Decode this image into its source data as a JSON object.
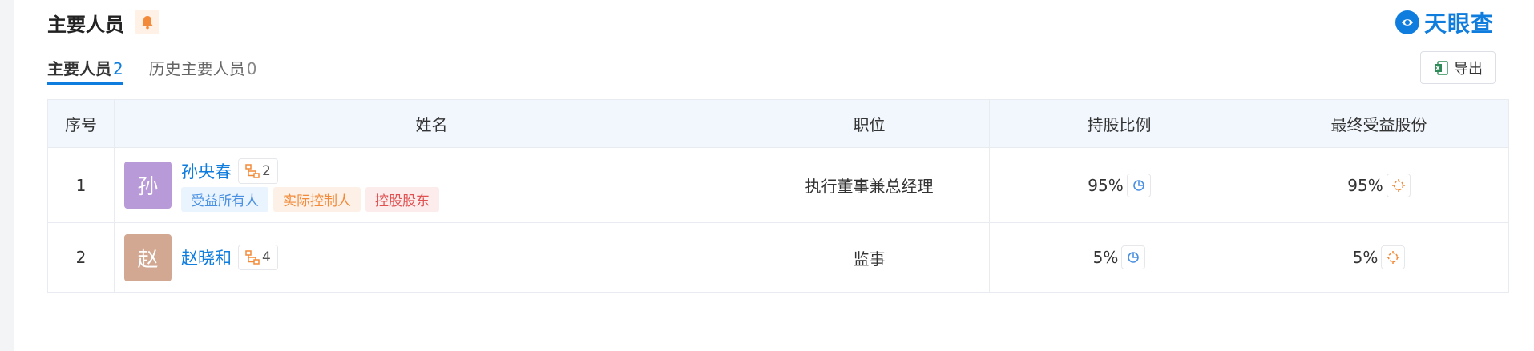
{
  "header": {
    "title": "主要人员",
    "logo_text": "天眼查"
  },
  "tabs": [
    {
      "label": "主要人员",
      "count": "2"
    },
    {
      "label": "历史主要人员",
      "count": "0"
    }
  ],
  "export_label": "导出",
  "table": {
    "columns": [
      "序号",
      "姓名",
      "职位",
      "持股比例",
      "最终受益股份"
    ],
    "rows": [
      {
        "index": "1",
        "avatar_char": "孙",
        "avatar_color": "#b99ad8",
        "name": "孙央春",
        "relation_count": "2",
        "tags": [
          "受益所有人",
          "实际控制人",
          "控股股东"
        ],
        "position": "执行董事兼总经理",
        "shareholding": "95%",
        "beneficial": "95%"
      },
      {
        "index": "2",
        "avatar_char": "赵",
        "avatar_color": "#d3a893",
        "name": "赵晓和",
        "relation_count": "4",
        "tags": [],
        "position": "监事",
        "shareholding": "5%",
        "beneficial": "5%"
      }
    ]
  },
  "colors": {
    "accent": "#0f7dde",
    "orange": "#f38a39",
    "header_bg": "#f2f7fd"
  }
}
